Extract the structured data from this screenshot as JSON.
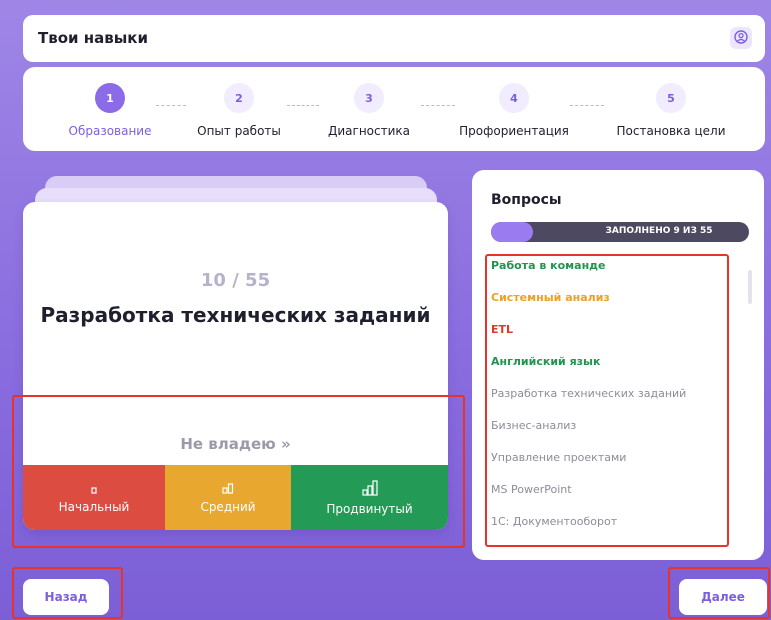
{
  "header": {
    "title": "Твои навыки",
    "profile_icon": "user-circle-icon"
  },
  "steps": [
    {
      "number": "1",
      "label": "Образование",
      "active": true
    },
    {
      "number": "2",
      "label": "Опыт работы",
      "active": false
    },
    {
      "number": "3",
      "label": "Диагностика",
      "active": false
    },
    {
      "number": "4",
      "label": "Профориентация",
      "active": false
    },
    {
      "number": "5",
      "label": "Постановка цели",
      "active": false
    }
  ],
  "card": {
    "counter": "10 / 55",
    "title": "Разработка технических заданий",
    "no_skill": "Не владею »",
    "levels": [
      {
        "label": "Начальный",
        "icon": "level-1-bars-icon",
        "color": "#dc4c40"
      },
      {
        "label": "Средний",
        "icon": "level-2-bars-icon",
        "color": "#e8a72e"
      },
      {
        "label": "Продвинутый",
        "icon": "level-3-bars-icon",
        "color": "#239b57"
      }
    ]
  },
  "questions": {
    "title": "Вопросы",
    "progress_text": "ЗАПОЛНЕНО 9 ИЗ 55",
    "progress_fraction": 0.164,
    "items": [
      {
        "label": "Работа в команде",
        "status": "advanced"
      },
      {
        "label": "Системный анализ",
        "status": "middle"
      },
      {
        "label": "ETL",
        "status": "beginner"
      },
      {
        "label": "Английский язык",
        "status": "advanced"
      },
      {
        "label": "Разработка технических заданий",
        "status": "none"
      },
      {
        "label": "Бизнес-анализ",
        "status": "none"
      },
      {
        "label": "Управление проектами",
        "status": "none"
      },
      {
        "label": "MS PowerPoint",
        "status": "none"
      },
      {
        "label": "1С: Документооборот",
        "status": "none"
      }
    ]
  },
  "nav": {
    "back_label": "Назад",
    "next_label": "Далее"
  },
  "colors": {
    "accent": "#8b6be8",
    "advanced": "#239b57",
    "middle": "#e8a72e",
    "beginner": "#dc4c40",
    "highlight_box": "#e6342a"
  }
}
